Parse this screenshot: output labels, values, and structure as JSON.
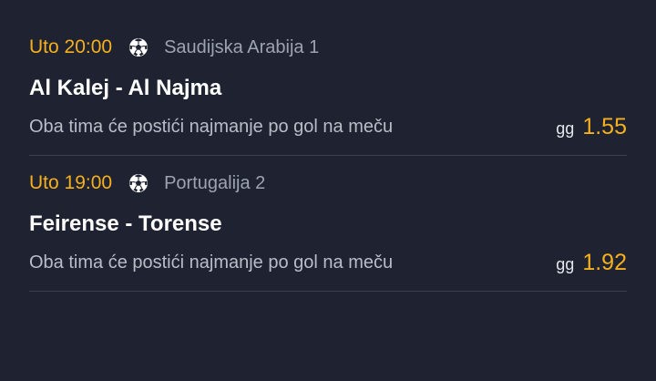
{
  "matches": [
    {
      "time": "Uto 20:00",
      "sport_icon": "soccer-ball-icon",
      "league": "Saudijska Arabija 1",
      "teams": "Al Kalej - Al Najma",
      "bet_description": "Oba tima će postići najmanje po gol na meču",
      "bet_code": "gg",
      "odds": "1.55"
    },
    {
      "time": "Uto 19:00",
      "sport_icon": "soccer-ball-icon",
      "league": "Portugalija 2",
      "teams": "Feirense - Torense",
      "bet_description": "Oba tima će postići najmanje po gol na meču",
      "bet_code": "gg",
      "odds": "1.92"
    }
  ],
  "colors": {
    "background": "#1f2331",
    "accent": "#f6b01d",
    "divider": "#3a3f4e",
    "muted_text": "#9ea3b0"
  }
}
